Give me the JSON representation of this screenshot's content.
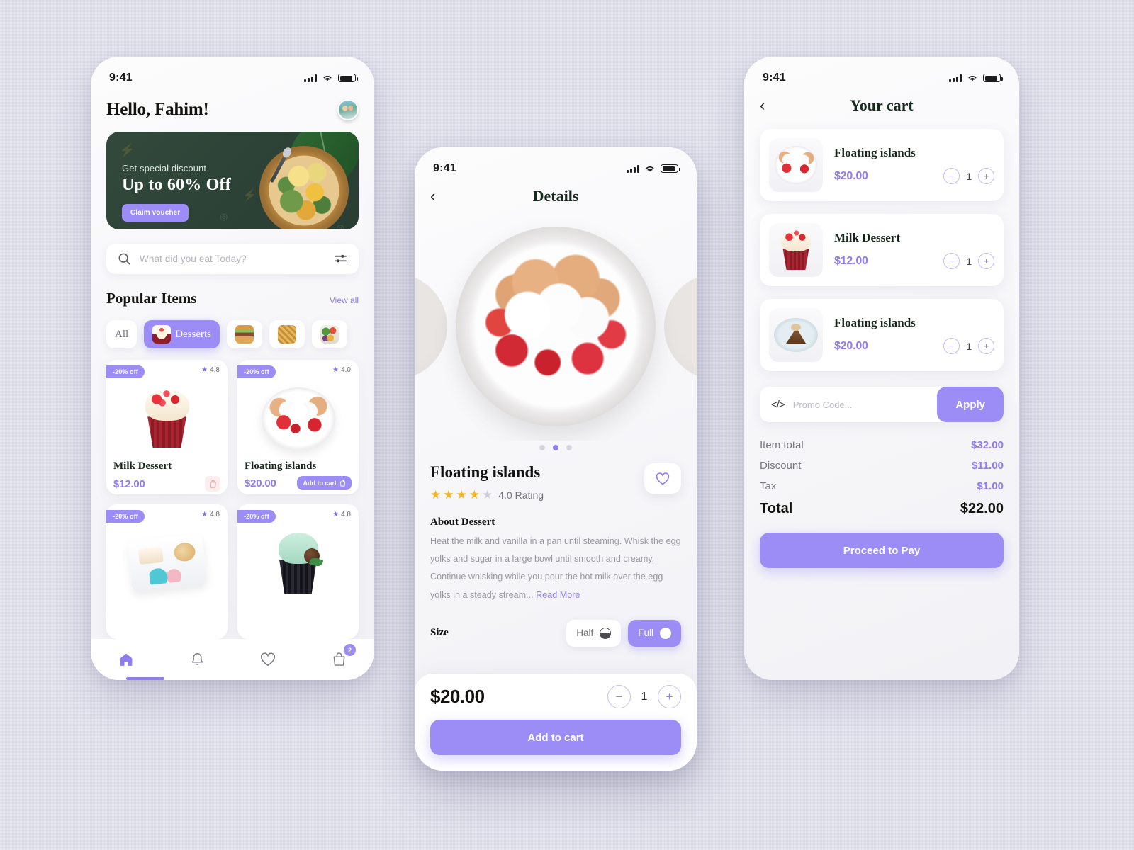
{
  "theme": {
    "accent": "#9c8df6",
    "accent_text": "#8f7cf0",
    "banner_green": "#2f4338",
    "background": "#dcdce9"
  },
  "status_bar": {
    "time": "9:41"
  },
  "home": {
    "greeting": "Hello, Fahim!",
    "banner": {
      "subtitle": "Get special discount",
      "title": "Up to 60% Off",
      "button": "Claim voucher"
    },
    "search": {
      "placeholder": "What did you eat Today?"
    },
    "section": {
      "title": "Popular Items",
      "view_all": "View all"
    },
    "categories": [
      {
        "label": "All",
        "icon": "",
        "active": false
      },
      {
        "label": "Desserts",
        "icon": "cupcake",
        "active": true
      },
      {
        "label": "",
        "icon": "burger",
        "active": false
      },
      {
        "label": "",
        "icon": "waffle",
        "active": false
      },
      {
        "label": "",
        "icon": "salad",
        "active": false
      }
    ],
    "products": [
      {
        "name": "Milk Dessert",
        "price": "$12.00",
        "discount": "-20% off",
        "rating": "4.8",
        "cta": ""
      },
      {
        "name": "Floating islands",
        "price": "$20.00",
        "discount": "-20% off",
        "rating": "4.0",
        "cta": "Add to cart"
      },
      {
        "name": "",
        "price": "",
        "discount": "-20% off",
        "rating": "4.8",
        "cta": ""
      },
      {
        "name": "",
        "price": "",
        "discount": "-20% off",
        "rating": "4.8",
        "cta": ""
      }
    ],
    "nav": {
      "cart_badge": "2"
    }
  },
  "details": {
    "title": "Details",
    "product_name": "Floating islands",
    "rating_value": "4.0 Rating",
    "stars_filled": 4,
    "stars_total": 5,
    "about_heading": "About Dessert",
    "description": "Heat the milk and vanilla in a pan until steaming. Whisk the egg yolks and sugar in a large bowl until smooth and creamy. Continue whisking while you pour the hot milk over the egg yolks in a steady stream...",
    "read_more": "Read More",
    "size_label": "Size",
    "size_options": [
      {
        "label": "Half",
        "selected": false
      },
      {
        "label": "Full",
        "selected": true
      }
    ],
    "price": "$20.00",
    "quantity": "1",
    "cta": "Add to cart",
    "carousel": {
      "dots": 3,
      "active": 2
    }
  },
  "cart": {
    "title": "Your cart",
    "items": [
      {
        "name": "Floating islands",
        "price": "$20.00",
        "qty": "1",
        "art": "floating"
      },
      {
        "name": "Milk Dessert",
        "price": "$12.00",
        "qty": "1",
        "art": "cupcake"
      },
      {
        "name": "Floating islands",
        "price": "$20.00",
        "qty": "1",
        "art": "pie"
      }
    ],
    "promo": {
      "placeholder": "Promo Code...",
      "apply": "Apply"
    },
    "totals": [
      {
        "label": "Item total",
        "value": "$32.00"
      },
      {
        "label": "Discount",
        "value": "$11.00"
      },
      {
        "label": "Tax",
        "value": "$1.00"
      }
    ],
    "grand": {
      "label": "Total",
      "value": "$22.00"
    },
    "pay_button": "Proceed to Pay"
  }
}
